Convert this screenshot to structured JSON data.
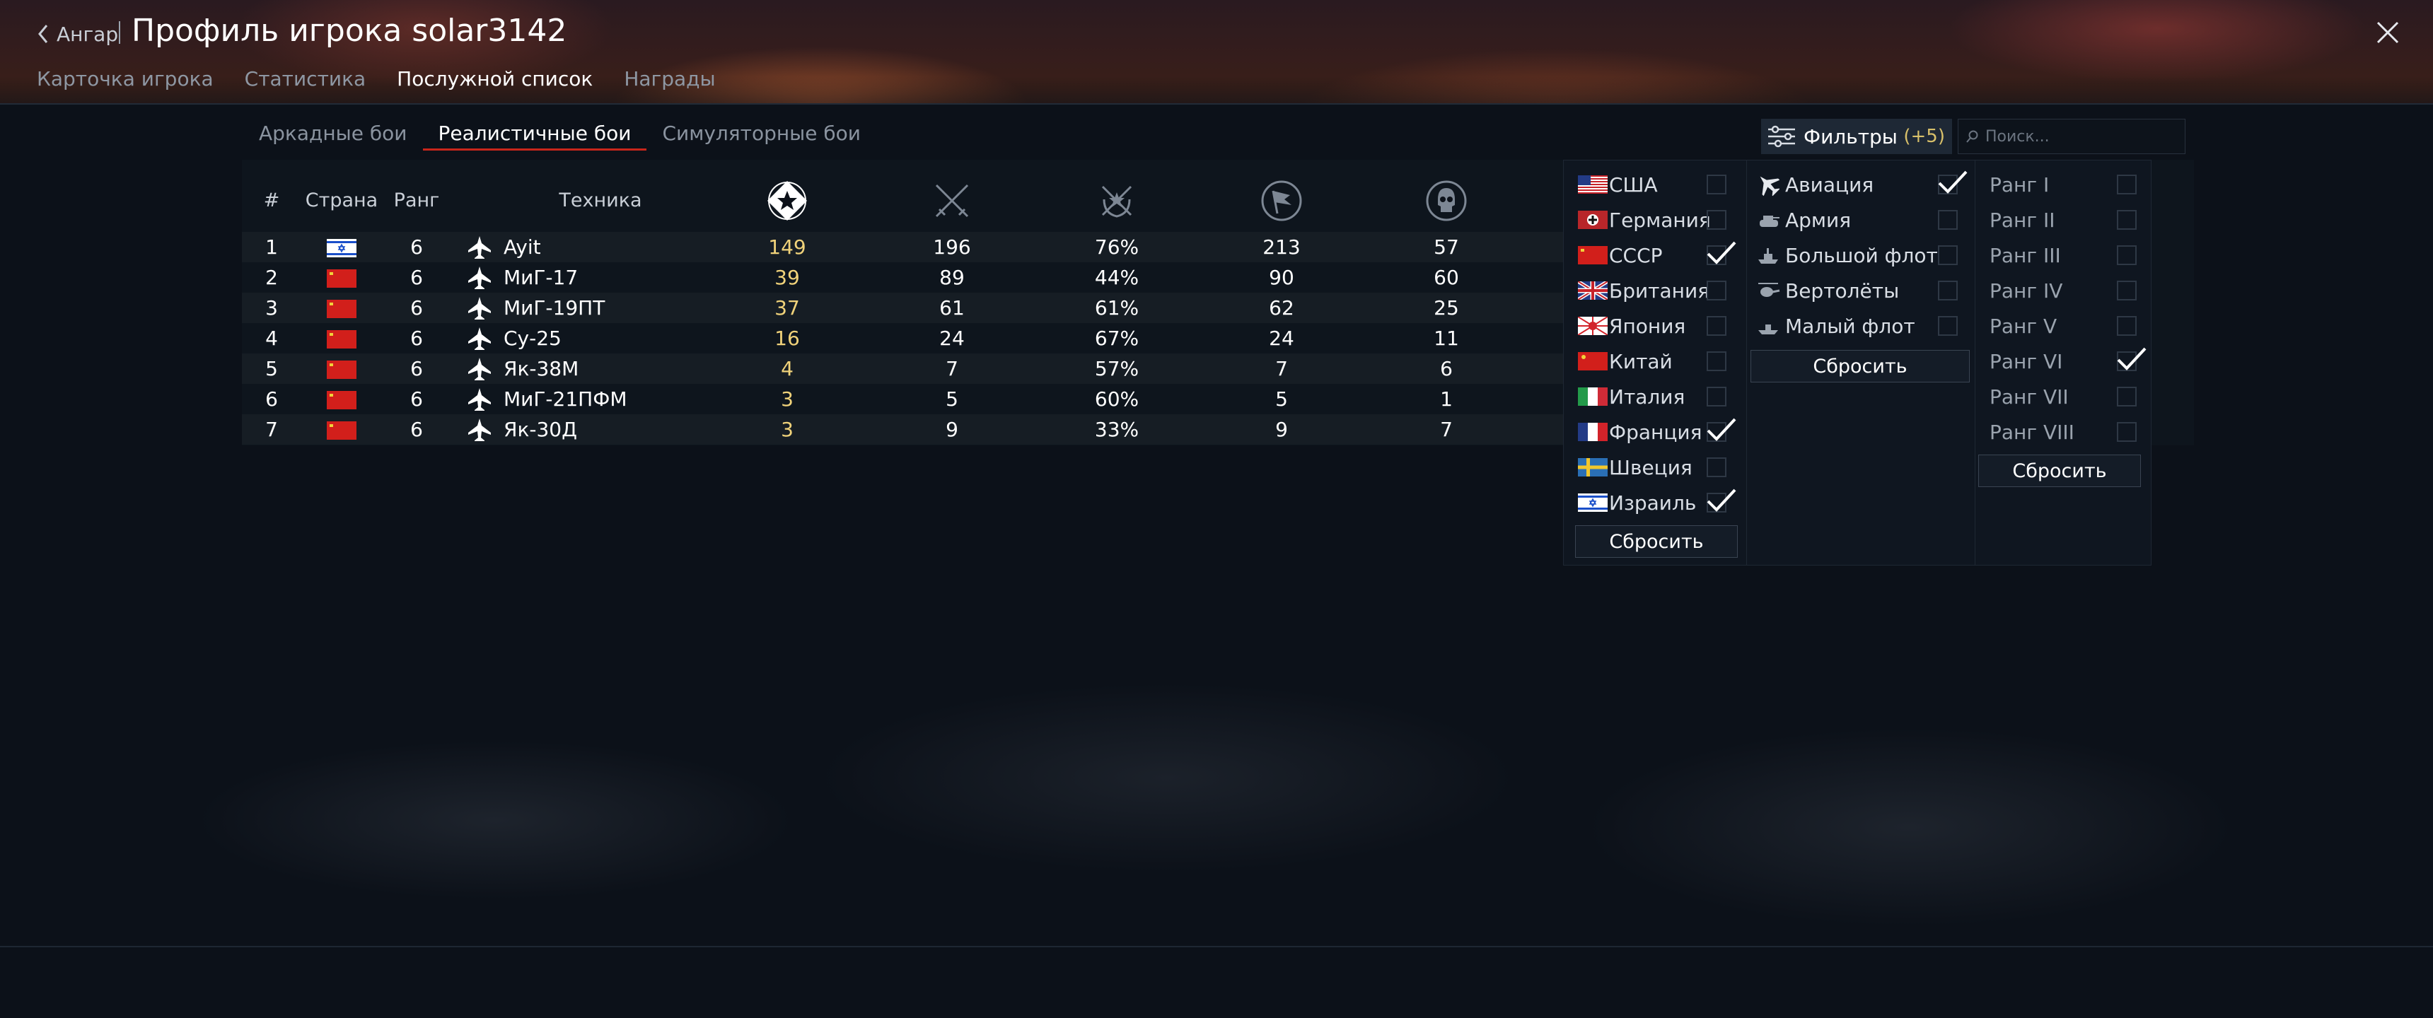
{
  "header": {
    "back_label": "Ангар",
    "title": "Профиль игрока solar3142"
  },
  "tabs": [
    {
      "label": "Карточка игрока",
      "active": false
    },
    {
      "label": "Статистика",
      "active": false
    },
    {
      "label": "Послужной список",
      "active": true
    },
    {
      "label": "Награды",
      "active": false
    }
  ],
  "mode_tabs": [
    {
      "label": "Аркадные бои",
      "active": false
    },
    {
      "label": "Реалистичные бои",
      "active": true
    },
    {
      "label": "Симуляторные бои",
      "active": false
    }
  ],
  "filters": {
    "label": "Фильтры",
    "count": "(+5)"
  },
  "search": {
    "placeholder": "Поиск..."
  },
  "table": {
    "headers": {
      "num": "#",
      "country": "Страна",
      "rank": "Ранг",
      "vehicle": "Техника"
    },
    "stat_icons": [
      "battles-star-icon",
      "crossed-swords-icon",
      "victory-wreath-icon",
      "capture-flag-icon",
      "skull-icon"
    ],
    "rows": [
      {
        "num": "1",
        "country": "israel",
        "rank": "6",
        "vehicle": "Ayit",
        "battles": "149",
        "c1": "196",
        "c2": "76%",
        "c3": "213",
        "c4": "57"
      },
      {
        "num": "2",
        "country": "ussr",
        "rank": "6",
        "vehicle": "МиГ-17",
        "battles": "39",
        "c1": "89",
        "c2": "44%",
        "c3": "90",
        "c4": "60"
      },
      {
        "num": "3",
        "country": "ussr",
        "rank": "6",
        "vehicle": "МиГ-19ПТ",
        "battles": "37",
        "c1": "61",
        "c2": "61%",
        "c3": "62",
        "c4": "25"
      },
      {
        "num": "4",
        "country": "ussr",
        "rank": "6",
        "vehicle": "Су-25",
        "battles": "16",
        "c1": "24",
        "c2": "67%",
        "c3": "24",
        "c4": "11"
      },
      {
        "num": "5",
        "country": "ussr",
        "rank": "6",
        "vehicle": "Як-38М",
        "battles": "4",
        "c1": "7",
        "c2": "57%",
        "c3": "7",
        "c4": "6"
      },
      {
        "num": "6",
        "country": "ussr",
        "rank": "6",
        "vehicle": "МиГ-21ПФМ",
        "battles": "3",
        "c1": "5",
        "c2": "60%",
        "c3": "5",
        "c4": "1"
      },
      {
        "num": "7",
        "country": "ussr",
        "rank": "6",
        "vehicle": "Як-30Д",
        "battles": "3",
        "c1": "9",
        "c2": "33%",
        "c3": "9",
        "c4": "7"
      }
    ]
  },
  "filter_dropdown": {
    "countries": [
      {
        "label": "США",
        "flag": "usa",
        "checked": false
      },
      {
        "label": "Германия",
        "flag": "germany",
        "checked": false
      },
      {
        "label": "СССР",
        "flag": "ussr",
        "checked": true
      },
      {
        "label": "Британия",
        "flag": "britain",
        "checked": false
      },
      {
        "label": "Япония",
        "flag": "japan",
        "checked": false
      },
      {
        "label": "Китай",
        "flag": "china",
        "checked": false
      },
      {
        "label": "Италия",
        "flag": "italy",
        "checked": false
      },
      {
        "label": "Франция",
        "flag": "france",
        "checked": true
      },
      {
        "label": "Швеция",
        "flag": "sweden",
        "checked": false
      },
      {
        "label": "Израиль",
        "flag": "israel",
        "checked": true
      }
    ],
    "types": [
      {
        "label": "Авиация",
        "icon": "aircraft-icon",
        "checked": true
      },
      {
        "label": "Армия",
        "icon": "tank-icon",
        "checked": false
      },
      {
        "label": "Большой флот",
        "icon": "bluewater-ship-icon",
        "checked": false
      },
      {
        "label": "Вертолёты",
        "icon": "helicopter-icon",
        "checked": false
      },
      {
        "label": "Малый флот",
        "icon": "coastal-boat-icon",
        "checked": false
      }
    ],
    "ranks": [
      {
        "label": "Ранг I",
        "checked": false
      },
      {
        "label": "Ранг II",
        "checked": false
      },
      {
        "label": "Ранг III",
        "checked": false
      },
      {
        "label": "Ранг IV",
        "checked": false
      },
      {
        "label": "Ранг V",
        "checked": false
      },
      {
        "label": "Ранг VI",
        "checked": true
      },
      {
        "label": "Ранг VII",
        "checked": false
      },
      {
        "label": "Ранг VIII",
        "checked": false
      }
    ],
    "reset_label": "Сбросить"
  },
  "colors": {
    "accent_red": "#c8261b",
    "gold": "#f0d27a",
    "panel": "#0f1620"
  }
}
